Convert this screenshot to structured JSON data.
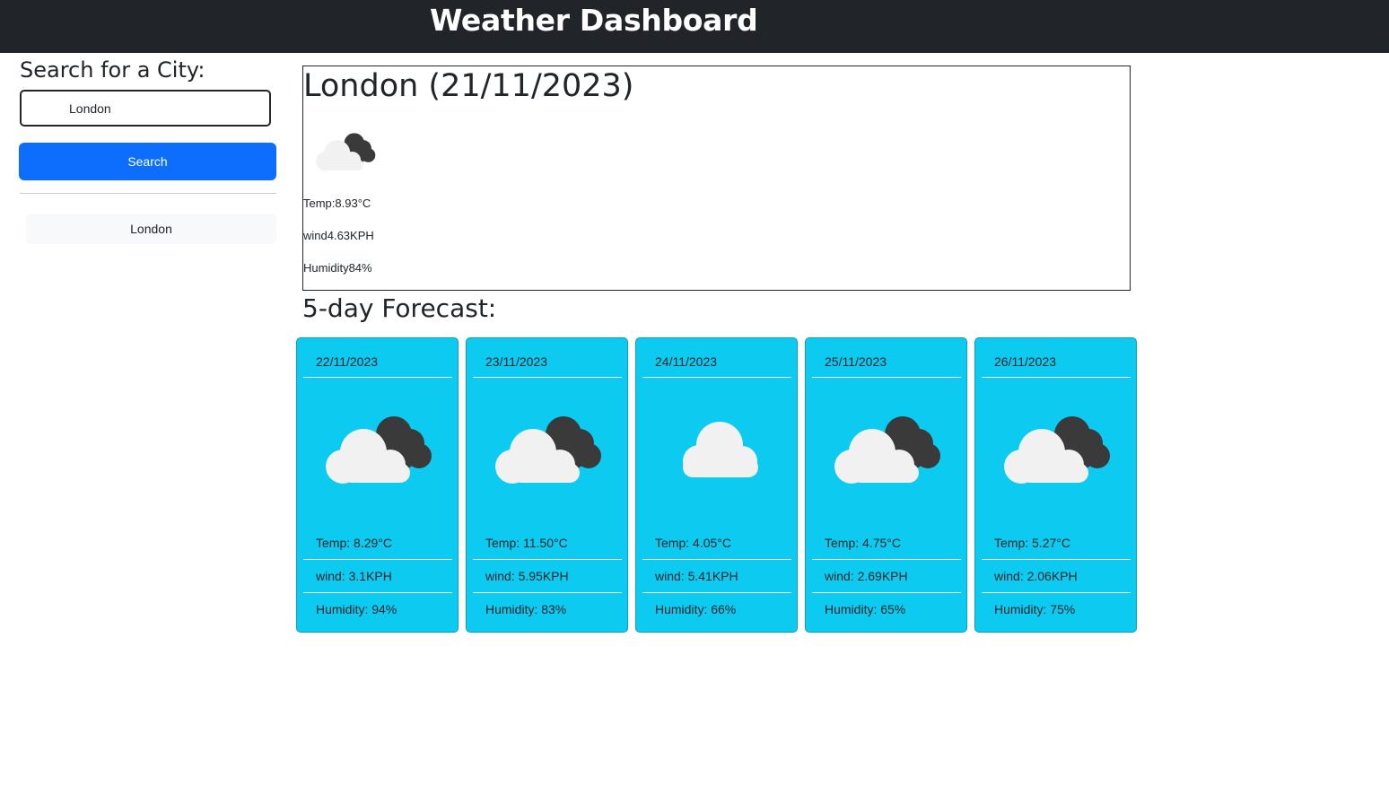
{
  "header": {
    "title": "Weather Dashboard"
  },
  "sidebar": {
    "search_label": "Search for a City:",
    "search_value": "London",
    "search_button": "Search",
    "history": [
      "London"
    ]
  },
  "current": {
    "heading": "London (21/11/2023)",
    "icon": "broken-clouds-icon",
    "temp": "Temp:8.93°C",
    "wind": "wind4.63KPH",
    "humidity": "Humidity84%"
  },
  "forecast": {
    "title": "5-day Forecast:",
    "card_color": "#0dcaf0",
    "days": [
      {
        "date": "22/11/2023",
        "icon": "broken-clouds-icon",
        "temp": "Temp: 8.29°C",
        "wind": "wind: 3.1KPH",
        "humidity": "Humidity: 94%"
      },
      {
        "date": "23/11/2023",
        "icon": "broken-clouds-icon",
        "temp": "Temp: 11.50°C",
        "wind": "wind: 5.95KPH",
        "humidity": "Humidity: 83%"
      },
      {
        "date": "24/11/2023",
        "icon": "cloud-icon",
        "temp": "Temp: 4.05°C",
        "wind": "wind: 5.41KPH",
        "humidity": "Humidity: 66%"
      },
      {
        "date": "25/11/2023",
        "icon": "broken-clouds-icon",
        "temp": "Temp: 4.75°C",
        "wind": "wind: 2.69KPH",
        "humidity": "Humidity: 65%"
      },
      {
        "date": "26/11/2023",
        "icon": "broken-clouds-icon",
        "temp": "Temp: 5.27°C",
        "wind": "wind: 2.06KPH",
        "humidity": "Humidity: 75%"
      }
    ]
  },
  "colors": {
    "header_bg": "#212529",
    "primary": "#0d6efd",
    "card": "#0dcaf0"
  }
}
